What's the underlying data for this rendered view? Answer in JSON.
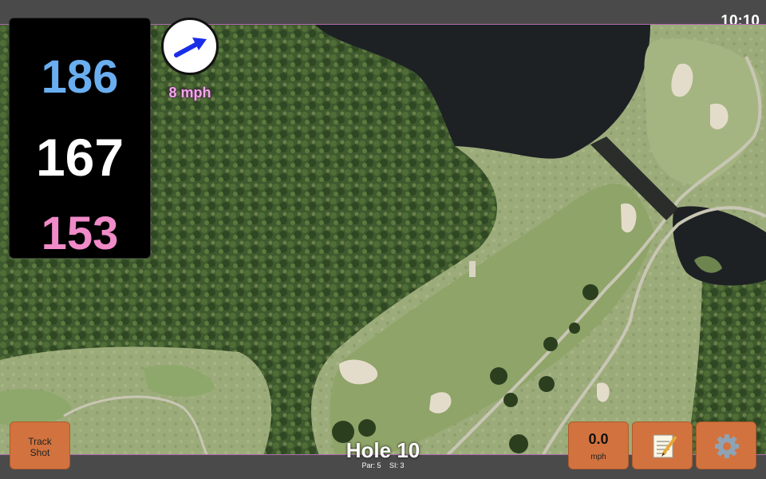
{
  "status": {
    "time": "10:10"
  },
  "yardage": {
    "back": "186",
    "center": "167",
    "front": "153"
  },
  "wind": {
    "speed_label": "8 mph",
    "direction_icon": "wind-arrow-icon",
    "arrow_color": "#1a2ee8"
  },
  "hole": {
    "title": "Hole 10",
    "par": "Par: 5",
    "si": "SI: 3"
  },
  "buttons": {
    "track_shot_line1": "Track",
    "track_shot_line2": "Shot",
    "speed_value": "0.0",
    "speed_unit": "mph",
    "notes_icon": "notepad-icon",
    "settings_icon": "gear-icon"
  },
  "colors": {
    "back": "#6aaef0",
    "center": "#ffffff",
    "front": "#f08ac8",
    "button": "#d2733f"
  }
}
